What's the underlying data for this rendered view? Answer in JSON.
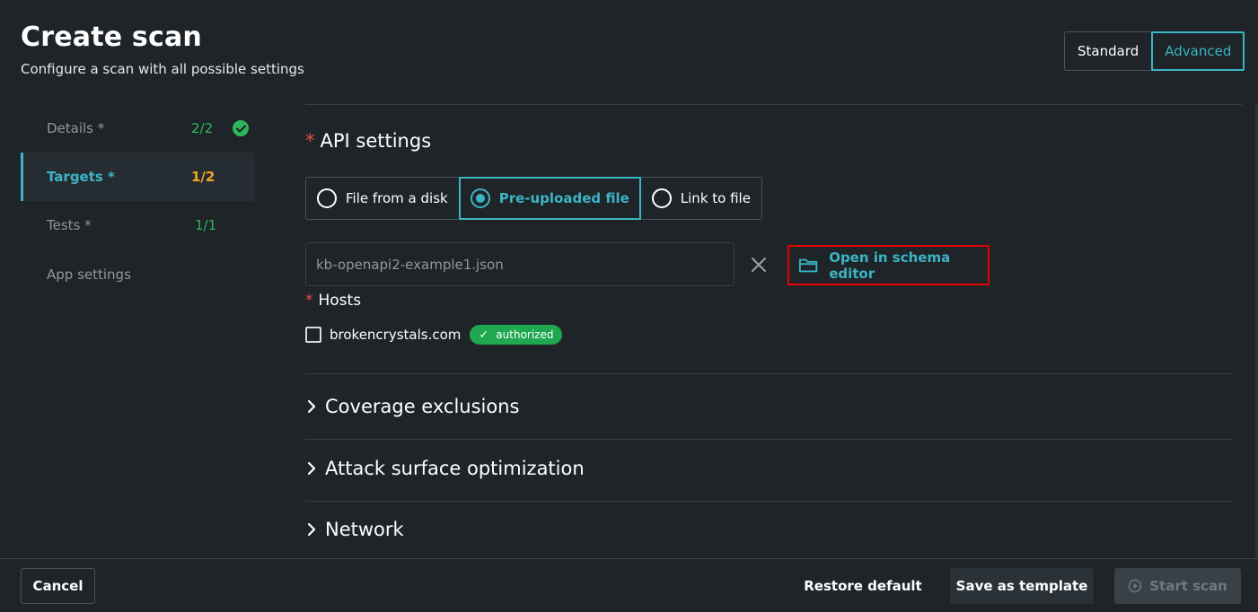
{
  "header": {
    "title": "Create scan",
    "subtitle": "Configure a scan with all possible settings",
    "modes": [
      "Standard",
      "Advanced"
    ],
    "active_mode": "Advanced"
  },
  "sidebar": {
    "items": [
      {
        "label": "Details *",
        "count": "2/2",
        "status": "complete"
      },
      {
        "label": "Targets *",
        "count": "1/2",
        "status": "active"
      },
      {
        "label": "Tests *",
        "count": "1/1",
        "status": "done"
      },
      {
        "label": "App settings",
        "count": "",
        "status": ""
      }
    ]
  },
  "api_settings": {
    "required_mark": "*",
    "title": "API settings",
    "source_options": [
      "File from a disk",
      "Pre-uploaded file",
      "Link to file"
    ],
    "selected_source": "Pre-uploaded file",
    "file_value": "kb-openapi2-example1.json",
    "schema_editor_label": "Open in schema editor"
  },
  "hosts": {
    "required_mark": "*",
    "title": "Hosts",
    "items": [
      {
        "name": "brokencrystals.com",
        "badge": "authorized",
        "badge_tick": "✓",
        "checked": false
      }
    ]
  },
  "sections": [
    {
      "label": "Coverage exclusions"
    },
    {
      "label": "Attack surface optimization"
    },
    {
      "label": "Network"
    }
  ],
  "footer": {
    "cancel_label": "Cancel",
    "restore_label": "Restore default",
    "save_template_label": "Save as template",
    "start_label": "Start scan"
  },
  "colors": {
    "background": "#1e2428",
    "accent": "#3bb4c4",
    "success": "#2eb85c",
    "warning": "#f5a623",
    "required": "#e5534b",
    "highlight": "#e00000"
  },
  "icons": {
    "sidebar_complete": "check-circle-icon",
    "clear": "close-icon",
    "schema_editor": "folder-icon",
    "accordion": "chevron-right-icon",
    "start": "play-circle-icon"
  }
}
